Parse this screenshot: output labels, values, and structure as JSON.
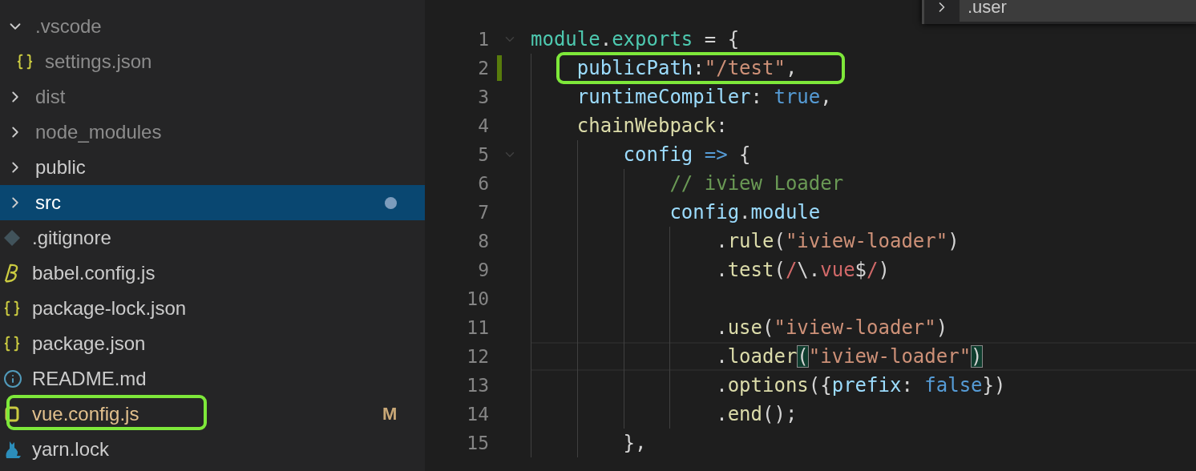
{
  "explorer": {
    "items": [
      {
        "label": ".vscode",
        "kind": "folder",
        "expanded": true,
        "ignored": true,
        "selected": false,
        "children": [
          {
            "label": "settings.json",
            "kind": "json",
            "ignored": true,
            "selected": false
          }
        ]
      },
      {
        "label": "dist",
        "kind": "folder",
        "expanded": false,
        "ignored": true,
        "selected": false
      },
      {
        "label": "node_modules",
        "kind": "folder",
        "expanded": false,
        "ignored": true,
        "selected": false
      },
      {
        "label": "public",
        "kind": "folder",
        "expanded": false,
        "ignored": false,
        "selected": false
      },
      {
        "label": "src",
        "kind": "folder",
        "expanded": false,
        "ignored": false,
        "selected": true,
        "modified_dot": true
      },
      {
        "label": ".gitignore",
        "kind": "git",
        "ignored": false,
        "selected": false
      },
      {
        "label": "babel.config.js",
        "kind": "babel",
        "ignored": false,
        "selected": false
      },
      {
        "label": "package-lock.json",
        "kind": "json",
        "ignored": false,
        "selected": false
      },
      {
        "label": "package.json",
        "kind": "json",
        "ignored": false,
        "selected": false
      },
      {
        "label": "README.md",
        "kind": "info",
        "ignored": false,
        "selected": false
      },
      {
        "label": "vue.config.js",
        "kind": "js",
        "ignored": false,
        "selected": false,
        "status": "M",
        "annotated": true
      },
      {
        "label": "yarn.lock",
        "kind": "yarn",
        "ignored": false,
        "selected": false
      }
    ]
  },
  "find_widget": {
    "value": ".user"
  },
  "editor": {
    "lines": [
      {
        "number": "1",
        "foldable": true,
        "tokens": [
          {
            "text": "module",
            "kind": "type"
          },
          {
            "text": ".",
            "kind": "punct"
          },
          {
            "text": "exports",
            "kind": "type"
          },
          {
            "text": " = {",
            "kind": "punct"
          }
        ]
      },
      {
        "number": "2",
        "modified": true,
        "annotated": true,
        "tokens": [
          {
            "text": "    publicPath",
            "kind": "prop"
          },
          {
            "text": ":",
            "kind": "punct"
          },
          {
            "text": "\"/test\"",
            "kind": "string"
          },
          {
            "text": ",",
            "kind": "punct"
          }
        ]
      },
      {
        "number": "3",
        "tokens": [
          {
            "text": "    runtimeCompiler",
            "kind": "prop"
          },
          {
            "text": ": ",
            "kind": "punct"
          },
          {
            "text": "true",
            "kind": "keyword"
          },
          {
            "text": ",",
            "kind": "punct"
          }
        ]
      },
      {
        "number": "4",
        "tokens": [
          {
            "text": "    chainWebpack",
            "kind": "func"
          },
          {
            "text": ":",
            "kind": "punct"
          }
        ]
      },
      {
        "number": "5",
        "foldable": true,
        "tokens": [
          {
            "text": "        config",
            "kind": "prop"
          },
          {
            "text": " =>",
            "kind": "keyword"
          },
          {
            "text": " {",
            "kind": "punct"
          }
        ]
      },
      {
        "number": "6",
        "tokens": [
          {
            "text": "            // iview Loader",
            "kind": "comment"
          }
        ]
      },
      {
        "number": "7",
        "tokens": [
          {
            "text": "            config",
            "kind": "prop"
          },
          {
            "text": ".",
            "kind": "punct"
          },
          {
            "text": "module",
            "kind": "prop"
          }
        ]
      },
      {
        "number": "8",
        "tokens": [
          {
            "text": "                .",
            "kind": "punct"
          },
          {
            "text": "rule",
            "kind": "func"
          },
          {
            "text": "(",
            "kind": "punct"
          },
          {
            "text": "\"iview-loader\"",
            "kind": "string"
          },
          {
            "text": ")",
            "kind": "punct"
          }
        ]
      },
      {
        "number": "9",
        "tokens": [
          {
            "text": "                .",
            "kind": "punct"
          },
          {
            "text": "test",
            "kind": "func"
          },
          {
            "text": "(",
            "kind": "punct"
          },
          {
            "text": "/",
            "kind": "regex"
          },
          {
            "text": "\\.",
            "kind": "punct"
          },
          {
            "text": "vue",
            "kind": "regex"
          },
          {
            "text": "$",
            "kind": "punct"
          },
          {
            "text": "/",
            "kind": "regex"
          },
          {
            "text": ")",
            "kind": "punct"
          }
        ]
      },
      {
        "number": "10"
      },
      {
        "number": "11",
        "tokens": [
          {
            "text": "                .",
            "kind": "punct"
          },
          {
            "text": "use",
            "kind": "func"
          },
          {
            "text": "(",
            "kind": "punct"
          },
          {
            "text": "\"iview-loader\"",
            "kind": "string"
          },
          {
            "text": ")",
            "kind": "punct"
          }
        ]
      },
      {
        "number": "12",
        "current": true,
        "tokens": [
          {
            "text": "                .",
            "kind": "punct"
          },
          {
            "text": "loader",
            "kind": "func"
          },
          {
            "text": "(",
            "kind": "bracket"
          },
          {
            "text": "\"iview-loader\"",
            "kind": "string"
          },
          {
            "text": ")",
            "kind": "bracket"
          }
        ]
      },
      {
        "number": "13",
        "tokens": [
          {
            "text": "                .",
            "kind": "punct"
          },
          {
            "text": "options",
            "kind": "func"
          },
          {
            "text": "({",
            "kind": "punct"
          },
          {
            "text": "prefix",
            "kind": "prop"
          },
          {
            "text": ": ",
            "kind": "punct"
          },
          {
            "text": "false",
            "kind": "keyword"
          },
          {
            "text": "})",
            "kind": "punct"
          }
        ]
      },
      {
        "number": "14",
        "tokens": [
          {
            "text": "                .",
            "kind": "punct"
          },
          {
            "text": "end",
            "kind": "func"
          },
          {
            "text": "();",
            "kind": "punct"
          }
        ]
      },
      {
        "number": "15",
        "tokens": [
          {
            "text": "        },",
            "kind": "punct"
          }
        ]
      }
    ]
  }
}
